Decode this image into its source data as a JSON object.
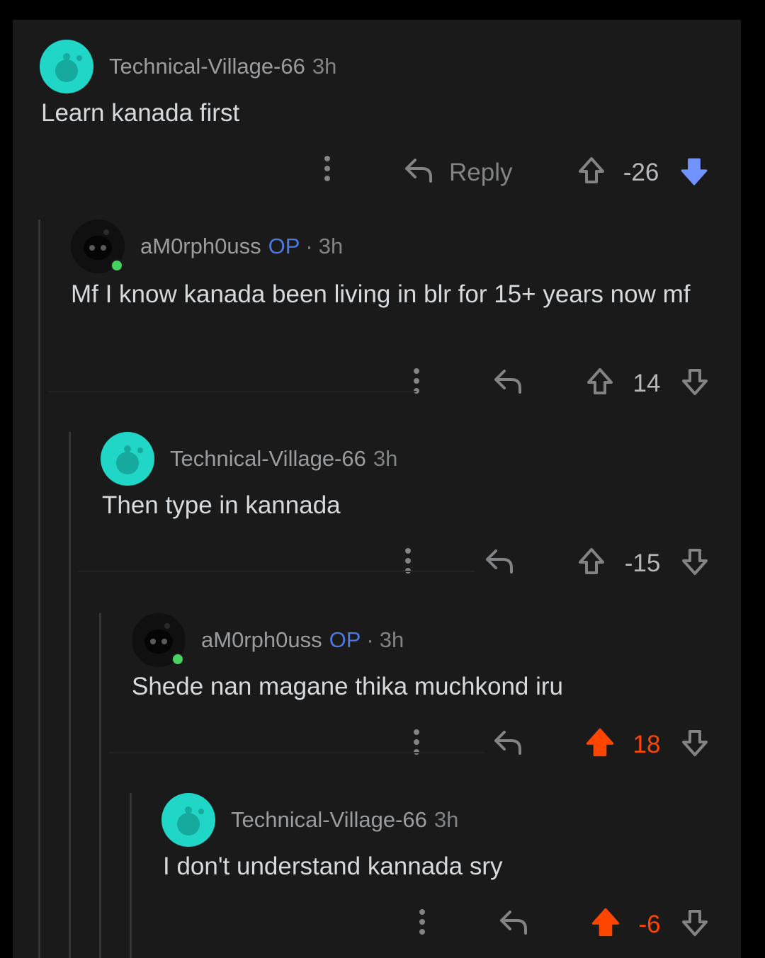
{
  "comments": [
    {
      "username": "Technical-Village-66",
      "time": "3h",
      "text": "Learn kanada first",
      "reply_label": "Reply",
      "score": "-26",
      "vote": "down",
      "avatar": "snoo-teal-avatar"
    },
    {
      "username": "aM0rph0uss",
      "op_label": "OP",
      "separator": "·",
      "time": "3h",
      "text": "Mf I know kanada been living in blr for 15+ years now mf",
      "score": "14",
      "vote": "none",
      "avatar": "snoo-dark-avatar"
    },
    {
      "username": "Technical-Village-66",
      "time": "3h",
      "text": "Then type in kannada",
      "score": "-15",
      "vote": "none",
      "avatar": "snoo-teal-avatar"
    },
    {
      "username": "aM0rph0uss",
      "op_label": "OP",
      "separator": "·",
      "time": "3h",
      "text": "Shede nan magane thika muchkond iru",
      "score": "18",
      "vote": "up",
      "avatar": "snoo-dark-avatar"
    },
    {
      "username": "Technical-Village-66",
      "time": "3h",
      "text": "I don't understand kannada sry",
      "score": "-6",
      "vote": "up",
      "avatar": "snoo-teal-avatar"
    }
  ],
  "colors": {
    "background": "#1a1a1b",
    "upvote_active": "#ff4500",
    "downvote_active": "#7193ff",
    "op": "#4d78e0",
    "online": "#46d160"
  }
}
